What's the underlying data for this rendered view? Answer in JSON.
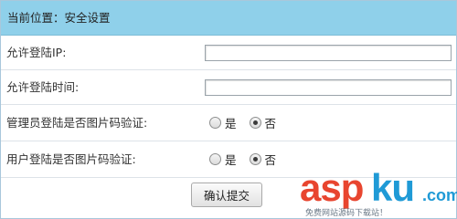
{
  "breadcrumb": {
    "prefix": "当前位置：",
    "current": "安全设置"
  },
  "form": {
    "allowed_ip": {
      "label": "允许登陆IP:",
      "value": ""
    },
    "allowed_time": {
      "label": "允许登陆时间:",
      "value": ""
    },
    "admin_captcha": {
      "label": "管理员登陆是否图片码验证:",
      "options": [
        "是",
        "否"
      ],
      "selected": "否"
    },
    "user_captcha": {
      "label": "用户登陆是否图片码验证:",
      "options": [
        "是",
        "否"
      ],
      "selected": "否"
    },
    "submit_label": "确认提交"
  },
  "watermark": {
    "brand_left": "asp",
    "brand_right": "ku",
    "brand_tld": ".com",
    "tagline": "免费网站源码下载站！"
  },
  "colors": {
    "header_bg": "#8fd0ea",
    "watermark_red": "#e8452f",
    "watermark_blue": "#1f9ad6"
  }
}
